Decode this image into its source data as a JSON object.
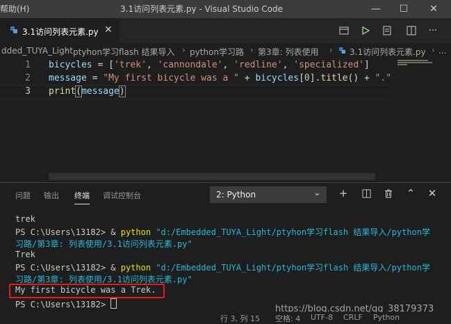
{
  "window": {
    "menu_help": "帮助(H)",
    "title": "3.1访问列表元素.py - Visual Studio Code"
  },
  "tab": {
    "label": "3.1访问列表元素.py"
  },
  "breadcrumb": [
    "dded_TUYA_Light",
    "ptyhon学习flash 结果导入",
    "python学习路",
    "第3章: 列表使用",
    "3.1访问列表元素.py",
    "..."
  ],
  "editor": {
    "lines": [
      {
        "num": "1",
        "code": "bicycles = ['trek', 'cannondale', 'redline', 'specialized']"
      },
      {
        "num": "2",
        "code": "message = \"My first bicycle was a \" + bicycles[0].title() + \".\""
      },
      {
        "num": "3",
        "code": "print(message)"
      }
    ]
  },
  "panel": {
    "tabs": [
      "问题",
      "输出",
      "终端",
      "调试控制台"
    ],
    "active_tab": "终端",
    "terminal_select": "2: Python",
    "terminal": {
      "l1": "trek",
      "l2_prefix": "PS C:\\Users\\13182> & ",
      "l2_cmd": "python",
      "l2_arg": " \"d:/Embedded_TUYA_Light/ptyhon学习flash 结果导入/python学",
      "l3": "习路/第3章: 列表使用/3.1访问列表元素.py\"",
      "l4": "Trek",
      "l5_prefix": "PS C:\\Users\\13182> & ",
      "l5_cmd": "python",
      "l5_arg": " \"d:/Embedded_TUYA_Light/ptyhon学习flash 结果导入/python学",
      "l6": "习路/第3章: 列表使用/3.1访问列表元素.py\"",
      "l7": "My first bicycle was a Trek.",
      "l8": "PS C:\\Users\\13182> "
    }
  },
  "status": {
    "position": "行 3, 列 15",
    "spaces": "空格: 4",
    "encoding": "UTF-8",
    "eol": "CRLF",
    "language": "Python"
  },
  "watermark": "https://blog.csdn.net/qq_38179373"
}
